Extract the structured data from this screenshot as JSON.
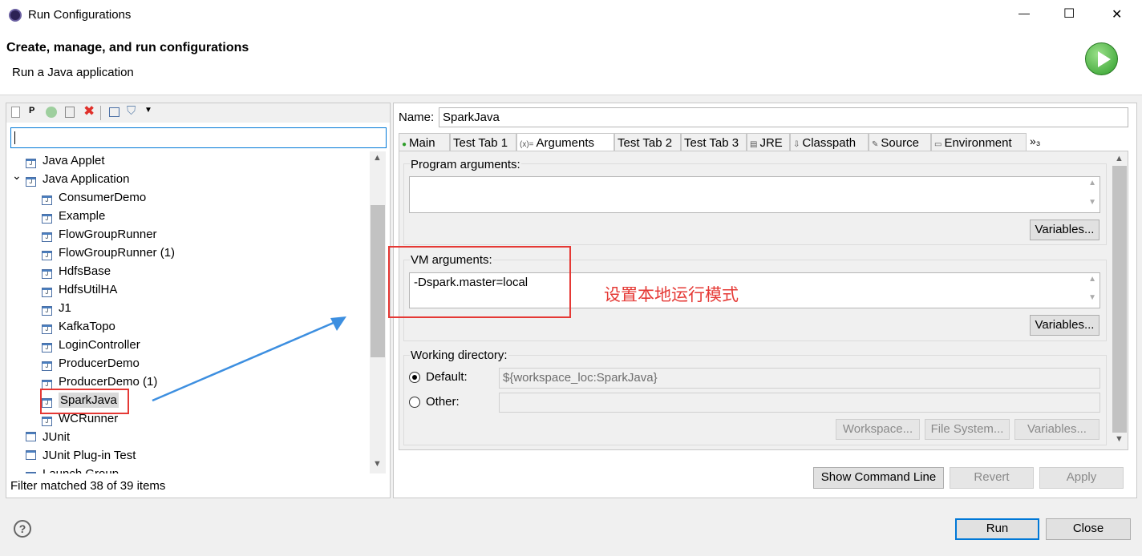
{
  "window": {
    "title": "Run Configurations",
    "minimize": "—",
    "maximize": "☐",
    "close": "✕"
  },
  "header": {
    "title": "Create, manage, and run configurations",
    "subtitle": "Run a Java application"
  },
  "toolbar": {
    "icons": [
      "new-configuration-icon",
      "new-prototype-icon",
      "duplicate-icon",
      "export-icon",
      "delete-icon",
      "collapse-all-icon",
      "filter-icon",
      "dropdown-icon"
    ]
  },
  "filter": {
    "value": "",
    "status": "Filter matched 38 of 39 items"
  },
  "tree": [
    {
      "label": "Java Applet",
      "level": 0
    },
    {
      "label": "Java Application",
      "level": 0,
      "expanded": true
    },
    {
      "label": "ConsumerDemo",
      "level": 1
    },
    {
      "label": "Example",
      "level": 1
    },
    {
      "label": "FlowGroupRunner",
      "level": 1
    },
    {
      "label": "FlowGroupRunner (1)",
      "level": 1
    },
    {
      "label": "HdfsBase",
      "level": 1
    },
    {
      "label": "HdfsUtilHA",
      "level": 1
    },
    {
      "label": "J1",
      "level": 1
    },
    {
      "label": "KafkaTopo",
      "level": 1
    },
    {
      "label": "LoginController",
      "level": 1
    },
    {
      "label": "ProducerDemo",
      "level": 1
    },
    {
      "label": "ProducerDemo (1)",
      "level": 1
    },
    {
      "label": "SparkJava",
      "level": 1,
      "selected": true
    },
    {
      "label": "WCRunner",
      "level": 1
    },
    {
      "label": "JUnit",
      "level": 0
    },
    {
      "label": "JUnit Plug-in Test",
      "level": 0
    },
    {
      "label": "Launch Group",
      "level": 0
    }
  ],
  "config": {
    "name_label": "Name:",
    "name_value": "SparkJava",
    "tabs": [
      "Main",
      "Test Tab 1",
      "Arguments",
      "Test Tab 2",
      "Test Tab 3",
      "JRE",
      "Classpath",
      "Source",
      "Environment"
    ],
    "tabs_more": "»₃",
    "selected_tab": "Arguments",
    "program_args_label": "Program arguments:",
    "program_args_value": "",
    "variables": "Variables...",
    "vm_args_label": "VM arguments:",
    "vm_args_value": "-Dspark.master=local",
    "annotation": "设置本地运行模式",
    "annotation_color": "#e53935",
    "working_dir_label": "Working directory:",
    "default_label": "Default:",
    "default_value": "${workspace_loc:SparkJava}",
    "other_label": "Other:",
    "other_value": "",
    "workspace": "Workspace...",
    "file_system": "File System...",
    "show_command_line": "Show Command Line",
    "revert": "Revert",
    "apply": "Apply"
  },
  "footer": {
    "run": "Run",
    "close": "Close"
  }
}
